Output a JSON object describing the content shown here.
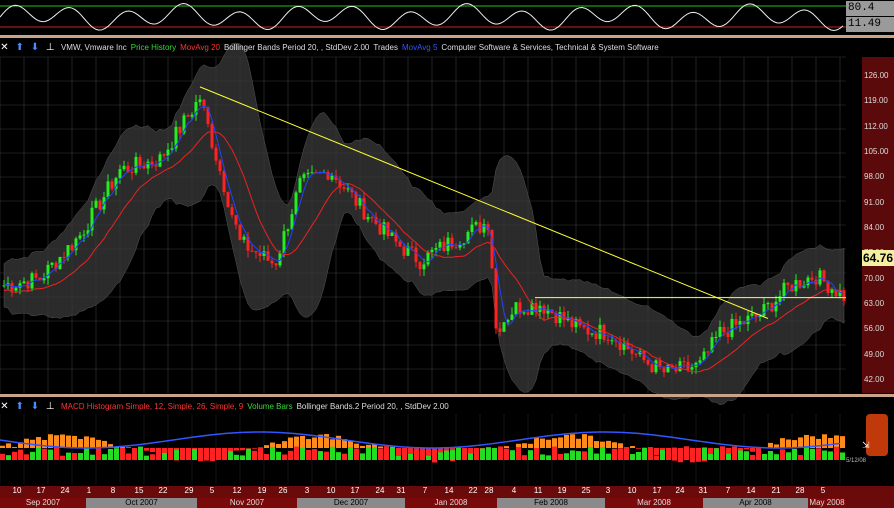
{
  "toolbar_icons": [
    "close-icon",
    "arrow-up-icon",
    "arrow-down-icon",
    "pin-icon"
  ],
  "readouts": {
    "top": "80.4",
    "bottom": "11.49"
  },
  "price_legend": [
    {
      "text": "VMW, Vmware Inc",
      "color": "#dddddd"
    },
    {
      "text": "Price History",
      "color": "#33dd33"
    },
    {
      "text": "MovAvg 20",
      "color": "#ff3333"
    },
    {
      "text": "Bollinger Bands Period 20, , StdDev 2.00",
      "color": "#dddddd"
    },
    {
      "text": "Trades",
      "color": "#dddddd"
    },
    {
      "text": "MovAvg 5",
      "color": "#3355ff"
    },
    {
      "text": "Computer Software & Services, Technical & System Software",
      "color": "#dddddd"
    }
  ],
  "macd_legend": [
    {
      "text": "MACD Histogram Simple, 12, Simple, 26, Simple, 9",
      "color": "#ff3333"
    },
    {
      "text": "Volume Bars",
      "color": "#33dd33"
    },
    {
      "text": "Bollinger Bands.2 Period 20, , StdDev 2.00",
      "color": "#dddddd"
    }
  ],
  "price_axis_ticks": [
    "126.00",
    "119.00",
    "112.00",
    "105.00",
    "98.00",
    "91.00",
    "84.00",
    "77.00",
    "70.00",
    "63.00",
    "56.00",
    "49.00",
    "42.00"
  ],
  "last_price": "64.76",
  "macd_corner_label": "5/12/08",
  "date_ticks": [
    "10",
    "17",
    "24",
    "1",
    "8",
    "15",
    "22",
    "29",
    "5",
    "12",
    "19",
    "26",
    "3",
    "10",
    "17",
    "24",
    "31",
    "7",
    "14",
    "22",
    "28",
    "4",
    "11",
    "19",
    "25",
    "3",
    "10",
    "17",
    "24",
    "31",
    "7",
    "14",
    "21",
    "28",
    "5"
  ],
  "months": [
    "Sep 2007",
    "Oct 2007",
    "Nov 2007",
    "Dec 2007",
    "Jan 2008",
    "Feb 2008",
    "Mar 2008",
    "Apr 2008",
    "May 2008"
  ],
  "colors": {
    "up": "#22ee22",
    "down": "#ff2222",
    "ma20": "#ee2222",
    "ma5": "#2244ff",
    "band": "#3a3a3a",
    "trend": "#ffff33",
    "grid": "#3a3a3a"
  },
  "chart_data": {
    "type": "candlestick",
    "ylim": [
      42,
      126
    ],
    "price_trend_points": [
      {
        "x": "Oct 29 2007",
        "y": 120
      },
      {
        "x": "Oct 5 2007",
        "y": 100
      },
      {
        "x": "Sep 10 2007",
        "y": 68
      },
      {
        "x": "Nov 1 2007",
        "y": 108
      },
      {
        "x": "Nov 26 2007",
        "y": 74
      },
      {
        "x": "Dec 10 2007",
        "y": 100
      },
      {
        "x": "Jan 7 2008",
        "y": 75
      },
      {
        "x": "Jan 28 2008",
        "y": 86
      },
      {
        "x": "Feb 1 2008",
        "y": 56
      },
      {
        "x": "Feb 11 2008",
        "y": 63
      },
      {
        "x": "Mar 17 2008",
        "y": 44
      },
      {
        "x": "Apr 7 2008",
        "y": 52
      },
      {
        "x": "Apr 28 2008",
        "y": 70
      },
      {
        "x": "May 12 2008",
        "y": 64.76
      }
    ]
  }
}
